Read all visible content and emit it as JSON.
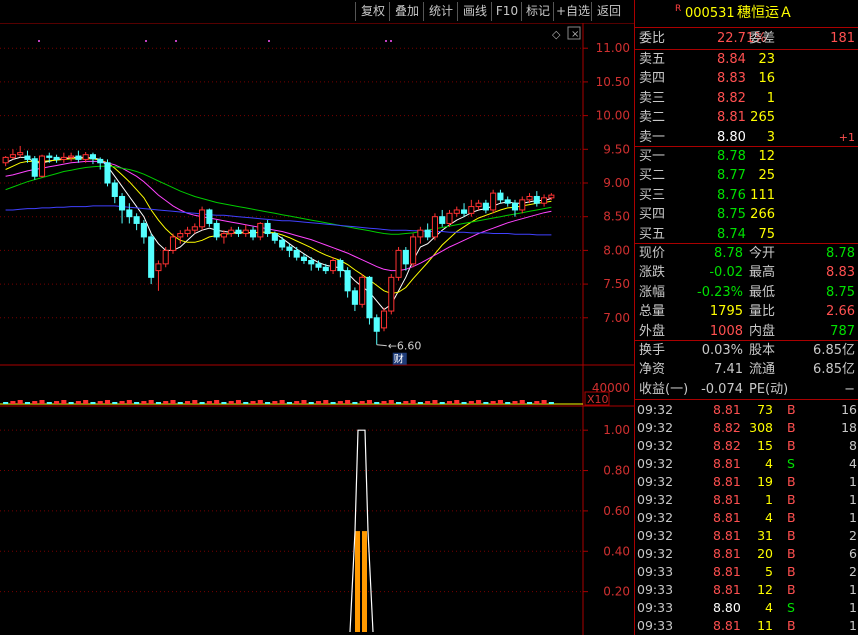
{
  "toolbar": {
    "buttons": [
      "复权",
      "叠加",
      "统计",
      "画线",
      "F10",
      "标记",
      "+自选",
      "返回"
    ]
  },
  "stock": {
    "flag": "R",
    "code": "000531",
    "name": "穗恒运Ａ"
  },
  "ratio": {
    "wb_label": "委比",
    "wb_value": "22.71%",
    "wc_label": "委差",
    "wc_value": "181"
  },
  "sell": [
    {
      "label": "卖五",
      "price": "8.84",
      "vol": "23"
    },
    {
      "label": "卖四",
      "price": "8.83",
      "vol": "16"
    },
    {
      "label": "卖三",
      "price": "8.82",
      "vol": "1"
    },
    {
      "label": "卖二",
      "price": "8.81",
      "vol": "265"
    },
    {
      "label": "卖一",
      "price": "8.80",
      "vol": "3",
      "chg": "+1"
    }
  ],
  "buy": [
    {
      "label": "买一",
      "price": "8.78",
      "vol": "12"
    },
    {
      "label": "买二",
      "price": "8.77",
      "vol": "25"
    },
    {
      "label": "买三",
      "price": "8.76",
      "vol": "111"
    },
    {
      "label": "买四",
      "price": "8.75",
      "vol": "266"
    },
    {
      "label": "买五",
      "price": "8.74",
      "vol": "75"
    }
  ],
  "quote": [
    {
      "l1": "现价",
      "v1": "8.78",
      "c1": "grn",
      "l2": "今开",
      "v2": "8.78",
      "c2": "grn"
    },
    {
      "l1": "涨跌",
      "v1": "-0.02",
      "c1": "grn",
      "l2": "最高",
      "v2": "8.83",
      "c2": "red"
    },
    {
      "l1": "涨幅",
      "v1": "-0.23%",
      "c1": "grn",
      "l2": "最低",
      "v2": "8.75",
      "c2": "grn"
    },
    {
      "l1": "总量",
      "v1": "1795",
      "c1": "yel",
      "l2": "量比",
      "v2": "2.66",
      "c2": "red"
    },
    {
      "l1": "外盘",
      "v1": "1008",
      "c1": "red",
      "l2": "内盘",
      "v2": "787",
      "c2": "grn"
    }
  ],
  "finance": [
    {
      "l1": "换手",
      "v1": "0.03%",
      "l2": "股本",
      "v2": "6.85亿"
    },
    {
      "l1": "净资",
      "v1": "7.41",
      "l2": "流通",
      "v2": "6.85亿"
    },
    {
      "l1": "收益(一)",
      "v1": "-0.074",
      "l2": "PE(动)",
      "v2": "−"
    }
  ],
  "ticks": [
    {
      "time": "09:32",
      "price": "8.81",
      "pc": "red",
      "vol": "73",
      "bs": "B",
      "n": "16"
    },
    {
      "time": "09:32",
      "price": "8.82",
      "pc": "red",
      "vol": "308",
      "bs": "B",
      "n": "18"
    },
    {
      "time": "09:32",
      "price": "8.82",
      "pc": "red",
      "vol": "15",
      "bs": "B",
      "n": "8"
    },
    {
      "time": "09:32",
      "price": "8.81",
      "pc": "red",
      "vol": "4",
      "bs": "S",
      "n": "4"
    },
    {
      "time": "09:32",
      "price": "8.81",
      "pc": "red",
      "vol": "19",
      "bs": "B",
      "n": "1"
    },
    {
      "time": "09:32",
      "price": "8.81",
      "pc": "red",
      "vol": "1",
      "bs": "B",
      "n": "1"
    },
    {
      "time": "09:32",
      "price": "8.81",
      "pc": "red",
      "vol": "4",
      "bs": "B",
      "n": "1"
    },
    {
      "time": "09:32",
      "price": "8.81",
      "pc": "red",
      "vol": "31",
      "bs": "B",
      "n": "2"
    },
    {
      "time": "09:32",
      "price": "8.81",
      "pc": "red",
      "vol": "20",
      "bs": "B",
      "n": "6"
    },
    {
      "time": "09:33",
      "price": "8.81",
      "pc": "red",
      "vol": "5",
      "bs": "B",
      "n": "2"
    },
    {
      "time": "09:33",
      "price": "8.81",
      "pc": "red",
      "vol": "12",
      "bs": "B",
      "n": "1"
    },
    {
      "time": "09:33",
      "price": "8.80",
      "pc": "wht",
      "vol": "4",
      "bs": "S",
      "n": "1"
    },
    {
      "time": "09:33",
      "price": "8.81",
      "pc": "red",
      "vol": "11",
      "bs": "B",
      "n": "1"
    }
  ],
  "chart_data": [
    {
      "type": "candlestick",
      "yticks": [
        "11.00",
        "10.50",
        "10.00",
        "9.50",
        "9.00",
        "8.50",
        "8.00",
        "7.50",
        "7.00"
      ],
      "ylim": [
        6.7,
        11.3
      ],
      "low_annotation": "6.60",
      "event_marker": "财",
      "candles": [
        [
          9.3,
          9.38,
          9.25,
          9.4
        ],
        [
          9.38,
          9.42,
          9.35,
          9.5
        ],
        [
          9.42,
          9.45,
          9.38,
          9.55
        ],
        [
          9.4,
          9.35,
          9.3,
          9.48
        ],
        [
          9.36,
          9.1,
          9.05,
          9.4
        ],
        [
          9.1,
          9.4,
          9.08,
          9.42
        ],
        [
          9.4,
          9.38,
          9.3,
          9.45
        ],
        [
          9.38,
          9.35,
          9.3,
          9.42
        ],
        [
          9.35,
          9.38,
          9.3,
          9.45
        ],
        [
          9.38,
          9.4,
          9.32,
          9.45
        ],
        [
          9.4,
          9.35,
          9.3,
          9.48
        ],
        [
          9.35,
          9.42,
          9.3,
          9.46
        ],
        [
          9.42,
          9.36,
          9.28,
          9.45
        ],
        [
          9.35,
          9.3,
          9.2,
          9.38
        ],
        [
          9.3,
          9.0,
          8.95,
          9.35
        ],
        [
          9.0,
          8.8,
          8.7,
          9.05
        ],
        [
          8.8,
          8.6,
          8.4,
          8.85
        ],
        [
          8.6,
          8.5,
          8.4,
          8.7
        ],
        [
          8.5,
          8.4,
          8.3,
          8.55
        ],
        [
          8.4,
          8.2,
          8.1,
          8.45
        ],
        [
          8.2,
          7.6,
          7.5,
          8.25
        ],
        [
          7.7,
          7.8,
          7.4,
          7.85
        ],
        [
          7.8,
          8.0,
          7.75,
          8.05
        ],
        [
          8.0,
          8.2,
          7.95,
          8.25
        ],
        [
          8.2,
          8.25,
          8.1,
          8.3
        ],
        [
          8.25,
          8.3,
          8.2,
          8.35
        ],
        [
          8.3,
          8.35,
          8.25,
          8.4
        ],
        [
          8.35,
          8.6,
          8.3,
          8.65
        ],
        [
          8.6,
          8.4,
          8.35,
          8.62
        ],
        [
          8.4,
          8.2,
          8.15,
          8.45
        ],
        [
          8.2,
          8.25,
          8.1,
          8.3
        ],
        [
          8.25,
          8.3,
          8.2,
          8.35
        ],
        [
          8.3,
          8.25,
          8.2,
          8.35
        ],
        [
          8.25,
          8.3,
          8.2,
          8.38
        ],
        [
          8.3,
          8.2,
          8.15,
          8.35
        ],
        [
          8.2,
          8.4,
          8.15,
          8.42
        ],
        [
          8.4,
          8.25,
          8.2,
          8.45
        ],
        [
          8.25,
          8.15,
          8.1,
          8.28
        ],
        [
          8.15,
          8.05,
          8.0,
          8.2
        ],
        [
          8.05,
          8.0,
          7.9,
          8.1
        ],
        [
          8.0,
          7.9,
          7.85,
          8.05
        ],
        [
          7.9,
          7.85,
          7.8,
          7.95
        ],
        [
          7.85,
          7.8,
          7.7,
          7.9
        ],
        [
          7.8,
          7.75,
          7.7,
          7.85
        ],
        [
          7.75,
          7.7,
          7.65,
          7.8
        ],
        [
          7.7,
          7.85,
          7.65,
          7.9
        ],
        [
          7.85,
          7.7,
          7.6,
          7.88
        ],
        [
          7.7,
          7.4,
          7.3,
          7.75
        ],
        [
          7.4,
          7.2,
          7.1,
          7.45
        ],
        [
          7.2,
          7.6,
          7.15,
          7.65
        ],
        [
          7.6,
          7.0,
          6.9,
          7.62
        ],
        [
          7.0,
          6.8,
          6.6,
          7.05
        ],
        [
          6.85,
          7.1,
          6.8,
          7.15
        ],
        [
          7.1,
          7.6,
          7.05,
          7.65
        ],
        [
          7.6,
          8.0,
          7.55,
          8.05
        ],
        [
          8.0,
          7.8,
          7.7,
          8.05
        ],
        [
          7.8,
          8.2,
          7.75,
          8.25
        ],
        [
          8.2,
          8.3,
          8.1,
          8.35
        ],
        [
          8.3,
          8.2,
          8.15,
          8.4
        ],
        [
          8.2,
          8.5,
          8.15,
          8.55
        ],
        [
          8.5,
          8.4,
          8.35,
          8.6
        ],
        [
          8.4,
          8.55,
          8.35,
          8.6
        ],
        [
          8.55,
          8.6,
          8.5,
          8.65
        ],
        [
          8.6,
          8.55,
          8.5,
          8.7
        ],
        [
          8.55,
          8.65,
          8.5,
          8.75
        ],
        [
          8.65,
          8.7,
          8.6,
          8.75
        ],
        [
          8.7,
          8.6,
          8.55,
          8.75
        ],
        [
          8.6,
          8.85,
          8.55,
          8.9
        ],
        [
          8.85,
          8.75,
          8.7,
          8.9
        ],
        [
          8.75,
          8.7,
          8.65,
          8.8
        ],
        [
          8.7,
          8.6,
          8.5,
          8.75
        ],
        [
          8.6,
          8.75,
          8.55,
          8.8
        ],
        [
          8.75,
          8.8,
          8.7,
          8.85
        ],
        [
          8.8,
          8.7,
          8.65,
          8.88
        ],
        [
          8.7,
          8.78,
          8.65,
          8.83
        ],
        [
          8.78,
          8.82,
          8.75,
          8.85
        ]
      ],
      "ma": [
        {
          "color": "#ffffff",
          "values": [
            9.3,
            9.35,
            9.38,
            9.38,
            9.3,
            9.3,
            9.32,
            9.35,
            9.36,
            9.38,
            9.38,
            9.38,
            9.37,
            9.35,
            9.25,
            9.1,
            8.95,
            8.8,
            8.65,
            8.5,
            8.25,
            8.1,
            8.0,
            8.0,
            8.05,
            8.15,
            8.25,
            8.3,
            8.33,
            8.3,
            8.28,
            8.27,
            8.27,
            8.27,
            8.26,
            8.27,
            8.27,
            8.25,
            8.18,
            8.1,
            8.02,
            7.95,
            7.88,
            7.82,
            7.78,
            7.76,
            7.74,
            7.66,
            7.55,
            7.46,
            7.38,
            7.25,
            7.12,
            7.2,
            7.4,
            7.6,
            7.85,
            8.05,
            8.1,
            8.2,
            8.3,
            8.38,
            8.45,
            8.5,
            8.56,
            8.6,
            8.62,
            8.66,
            8.7,
            8.72,
            8.7,
            8.7,
            8.72,
            8.74,
            8.74,
            8.77
          ]
        },
        {
          "color": "#ffff00",
          "values": [
            9.2,
            9.25,
            9.3,
            9.32,
            9.32,
            9.32,
            9.33,
            9.34,
            9.35,
            9.36,
            9.36,
            9.36,
            9.36,
            9.34,
            9.3,
            9.22,
            9.12,
            9.02,
            8.9,
            8.78,
            8.6,
            8.45,
            8.32,
            8.22,
            8.15,
            8.12,
            8.12,
            8.15,
            8.2,
            8.22,
            8.24,
            8.25,
            8.26,
            8.26,
            8.26,
            8.27,
            8.27,
            8.26,
            8.23,
            8.19,
            8.14,
            8.09,
            8.04,
            7.98,
            7.93,
            7.89,
            7.85,
            7.79,
            7.71,
            7.64,
            7.56,
            7.48,
            7.4,
            7.36,
            7.38,
            7.45,
            7.58,
            7.7,
            7.82,
            7.95,
            8.08,
            8.18,
            8.28,
            8.35,
            8.42,
            8.48,
            8.52,
            8.56,
            8.6,
            8.63,
            8.64,
            8.66,
            8.68,
            8.7,
            8.71,
            8.73
          ]
        },
        {
          "color": "#ff44ff",
          "values": [
            9.1,
            9.12,
            9.15,
            9.18,
            9.2,
            9.22,
            9.24,
            9.26,
            9.28,
            9.3,
            9.31,
            9.32,
            9.32,
            9.32,
            9.3,
            9.27,
            9.22,
            9.16,
            9.1,
            9.02,
            8.92,
            8.82,
            8.74,
            8.66,
            8.6,
            8.55,
            8.52,
            8.5,
            8.48,
            8.46,
            8.44,
            8.42,
            8.4,
            8.38,
            8.36,
            8.34,
            8.32,
            8.3,
            8.28,
            8.25,
            8.22,
            8.19,
            8.16,
            8.12,
            8.08,
            8.04,
            8.0,
            7.96,
            7.91,
            7.86,
            7.81,
            7.76,
            7.72,
            7.7,
            7.7,
            7.72,
            7.76,
            7.81,
            7.87,
            7.93,
            7.99,
            8.05,
            8.1,
            8.15,
            8.2,
            8.25,
            8.29,
            8.33,
            8.37,
            8.41,
            8.44,
            8.47,
            8.5,
            8.53,
            8.56,
            8.58
          ]
        },
        {
          "color": "#00cc00",
          "values": [
            8.9,
            8.94,
            8.98,
            9.02,
            9.05,
            9.08,
            9.11,
            9.14,
            9.17,
            9.19,
            9.21,
            9.23,
            9.24,
            9.25,
            9.25,
            9.24,
            9.22,
            9.2,
            9.17,
            9.13,
            9.08,
            9.03,
            8.98,
            8.93,
            8.88,
            8.84,
            8.8,
            8.77,
            8.74,
            8.71,
            8.69,
            8.67,
            8.65,
            8.63,
            8.61,
            8.59,
            8.57,
            8.55,
            8.53,
            8.51,
            8.49,
            8.47,
            8.45,
            8.43,
            8.41,
            8.39,
            8.37,
            8.35,
            8.33,
            8.31,
            8.29,
            8.27,
            8.25,
            8.24,
            8.24,
            8.25,
            8.26,
            8.28,
            8.3,
            8.32,
            8.34,
            8.36,
            8.38,
            8.4,
            8.42,
            8.44,
            8.46,
            8.48,
            8.5,
            8.52,
            8.54,
            8.56,
            8.58,
            8.6,
            8.62,
            8.64
          ]
        },
        {
          "color": "#4040ff",
          "values": [
            8.6,
            8.6,
            8.61,
            8.62,
            8.62,
            8.63,
            8.63,
            8.64,
            8.64,
            8.65,
            8.65,
            8.65,
            8.66,
            8.66,
            8.66,
            8.66,
            8.65,
            8.64,
            8.63,
            8.62,
            8.61,
            8.6,
            8.59,
            8.58,
            8.57,
            8.56,
            8.55,
            8.54,
            8.53,
            8.52,
            8.52,
            8.51,
            8.5,
            8.49,
            8.48,
            8.47,
            8.46,
            8.45,
            8.44,
            8.44,
            8.43,
            8.42,
            8.41,
            8.4,
            8.39,
            8.38,
            8.37,
            8.36,
            8.35,
            8.34,
            8.33,
            8.32,
            8.31,
            8.3,
            8.3,
            8.3,
            8.29,
            8.29,
            8.28,
            8.28,
            8.28,
            8.27,
            8.27,
            8.27,
            8.26,
            8.26,
            8.26,
            8.25,
            8.25,
            8.25,
            8.24,
            8.24,
            8.24,
            8.23,
            8.23,
            8.23
          ]
        }
      ]
    },
    {
      "type": "bar",
      "name": "volume",
      "ytick": "40000",
      "scale_label": "X10"
    },
    {
      "type": "area",
      "yticks": [
        "1.00",
        "0.80",
        "0.60",
        "0.40",
        "0.20"
      ],
      "ylim": [
        0,
        1.1
      ],
      "peak_values": [
        0,
        0.5,
        1.0,
        1.0,
        0.5,
        0
      ],
      "bar_values": [
        0.5,
        0.5
      ]
    }
  ]
}
